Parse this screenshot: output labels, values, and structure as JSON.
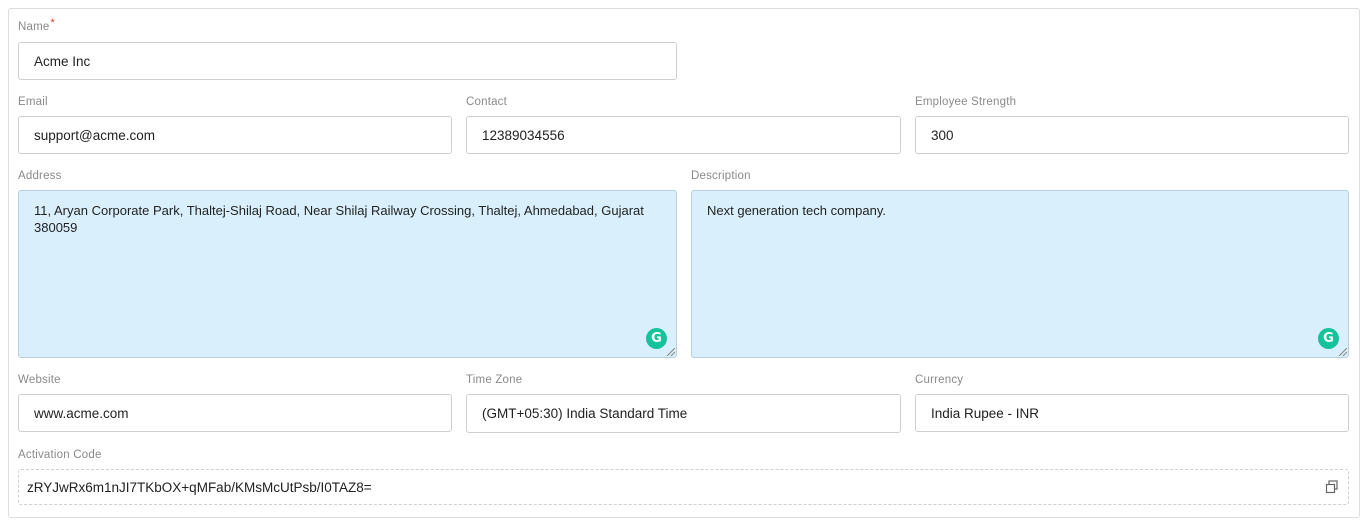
{
  "form": {
    "name": {
      "label": "Name",
      "required_mark": "*",
      "value": "Acme Inc"
    },
    "email": {
      "label": "Email",
      "value": "support@acme.com"
    },
    "contact": {
      "label": "Contact",
      "value": "12389034556"
    },
    "employee_strength": {
      "label": "Employee Strength",
      "value": "300"
    },
    "address": {
      "label": "Address",
      "value": "11, Aryan Corporate Park, Thaltej-Shilaj Road, Near Shilaj Railway Crossing, Thaltej, Ahmedabad, Gujarat 380059"
    },
    "description": {
      "label": "Description",
      "value": "Next generation tech company."
    },
    "website": {
      "label": "Website",
      "value": "www.acme.com"
    },
    "time_zone": {
      "label": "Time Zone",
      "value": "(GMT+05:30) India Standard Time"
    },
    "currency": {
      "label": "Currency",
      "value": "India Rupee - INR"
    },
    "activation_code": {
      "label": "Activation Code",
      "value": "zRYJwRx6m1nJI7TKbOX+qMFab/KMsMcUtPsb/I0TAZ8="
    }
  },
  "icons": {
    "grammarly": "grammarly-icon",
    "copy": "copy-icon"
  },
  "colors": {
    "textarea_bg": "#d9f0fc",
    "grammarly": "#15c39a",
    "required": "#e53935"
  }
}
